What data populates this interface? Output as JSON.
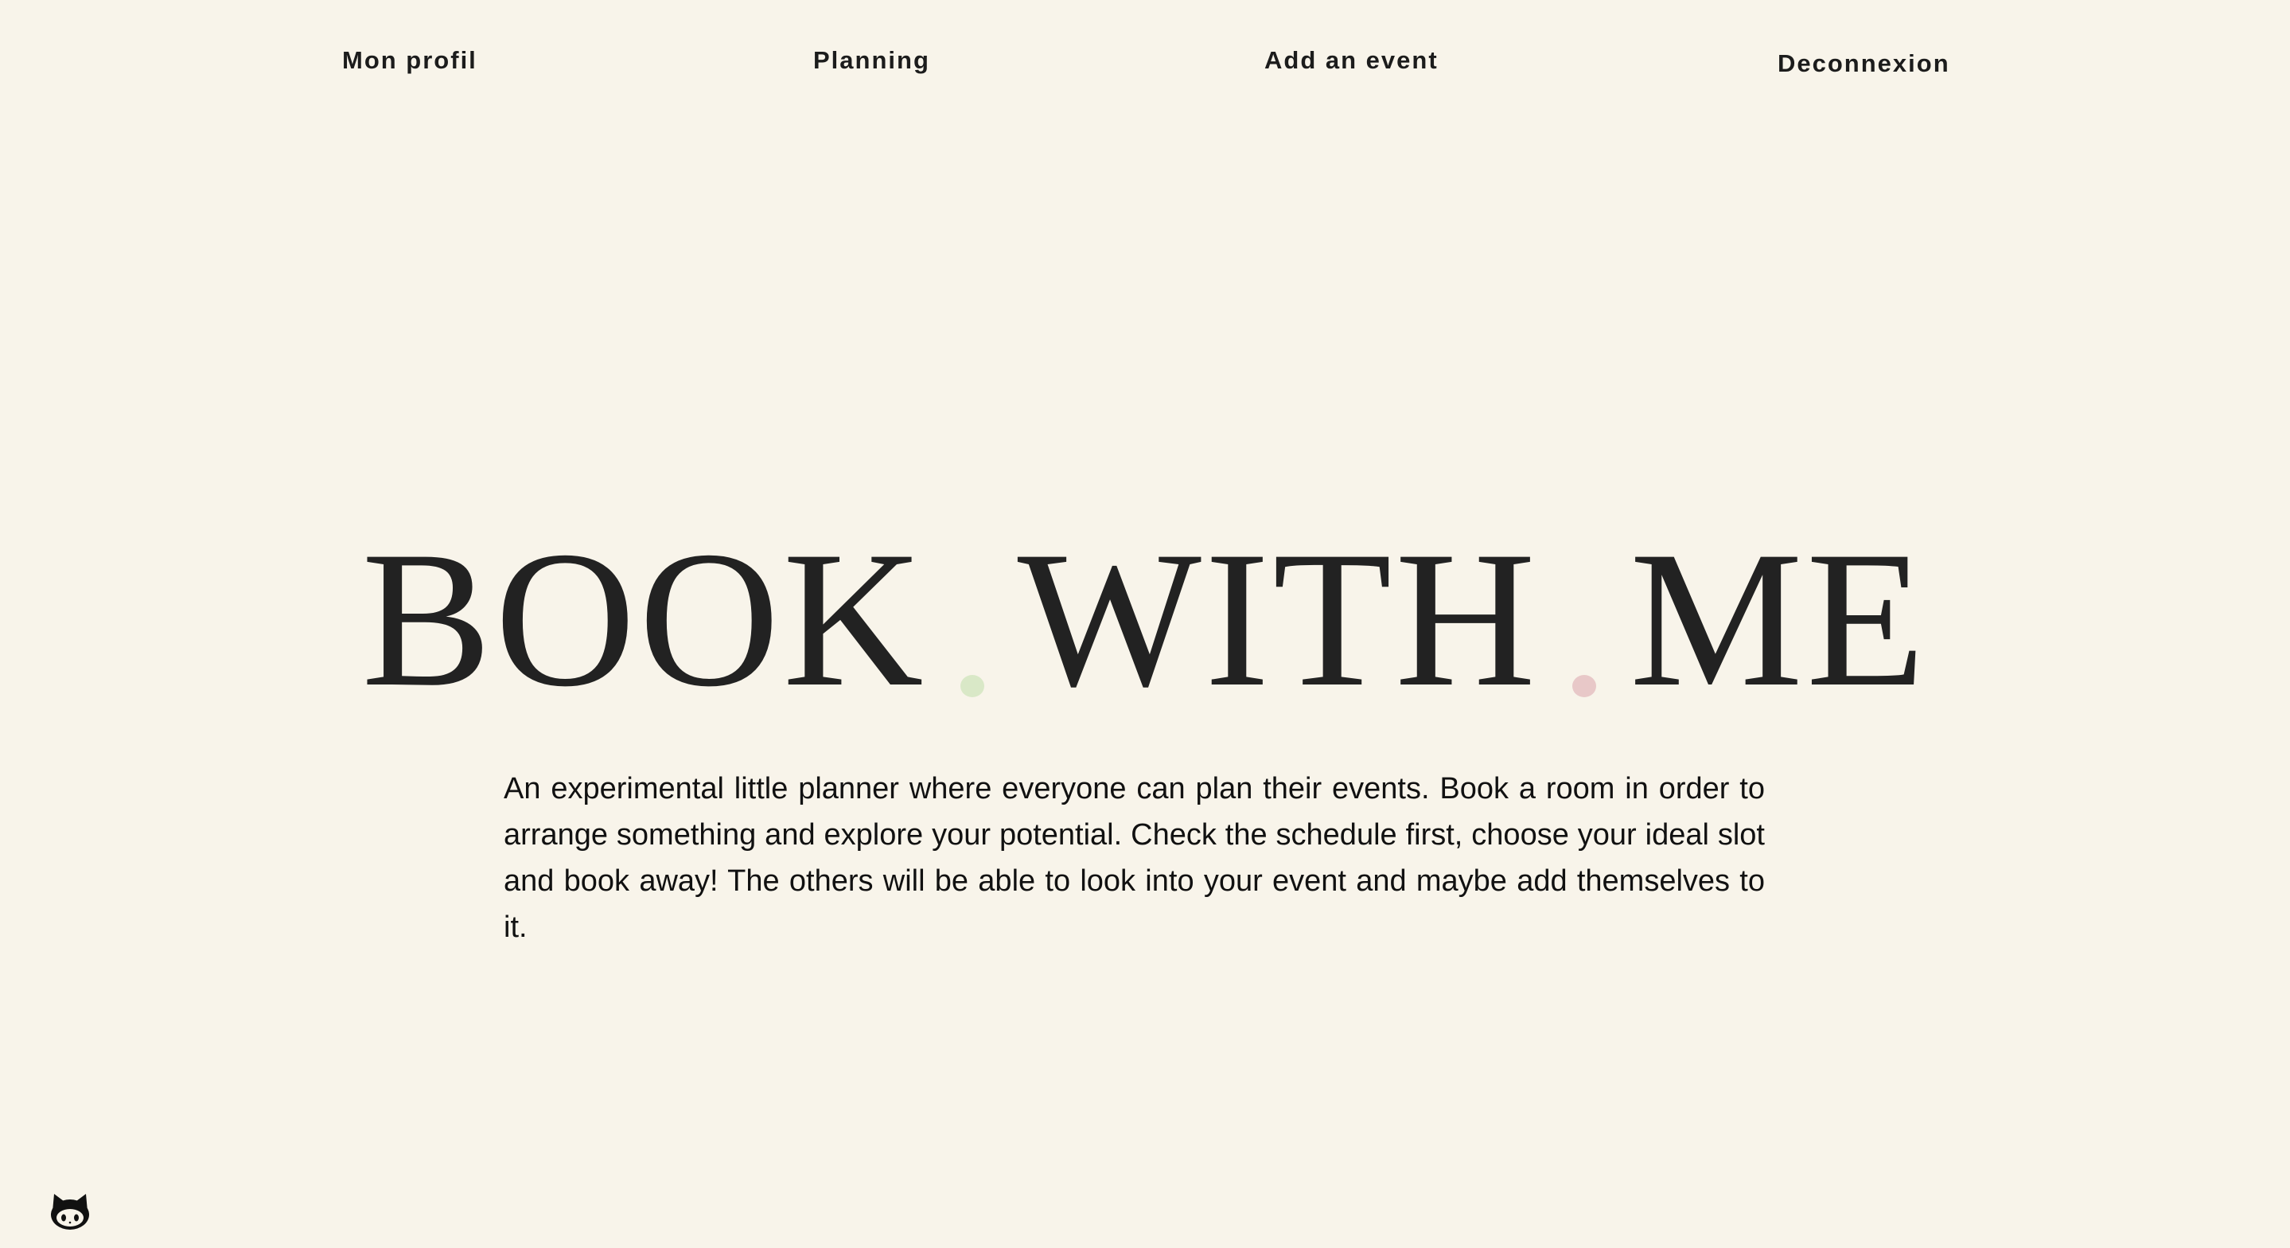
{
  "nav": {
    "profil": "Mon profil",
    "planning": "Planning",
    "add_event": "Add an event",
    "logout": "Deconnexion"
  },
  "hero": {
    "word1": "BOOK",
    "word2": "WITH",
    "word3": "ME",
    "dot1_color": "#d9e8c7",
    "dot2_color": "#e8c8c8"
  },
  "description": "An experimental little planner where everyone can plan their events. Book a room in order to arrange something and explore your potential. Check the schedule first, choose your ideal slot and book away! The others will be able to look into your event and maybe add themselves to it.",
  "footer": {
    "icon": "github-icon"
  },
  "colors": {
    "background": "#f8f4ea",
    "text": "#1f1f1f"
  }
}
